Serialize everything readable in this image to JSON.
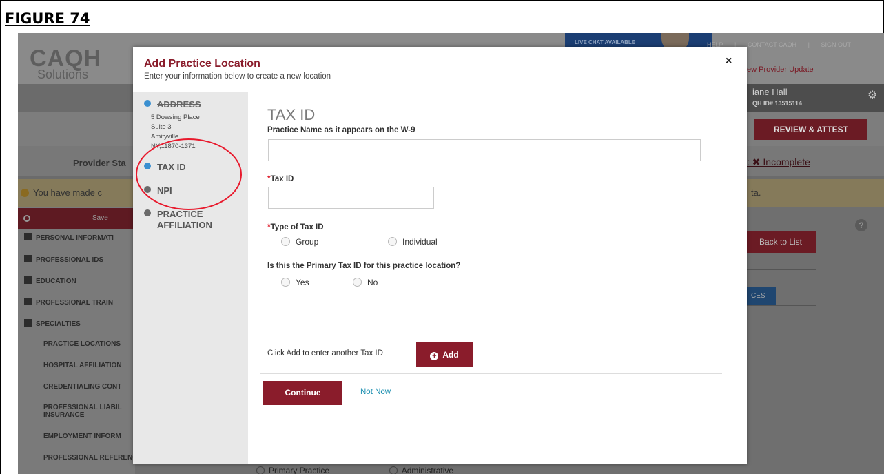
{
  "figure_title": "FIGURE 74",
  "background": {
    "logo_main": "CAQH",
    "logo_sub": "Solutions",
    "live_chat": "LIVE CHAT AVAILABLE",
    "top_links": [
      "HELP",
      "|",
      "CONTACT CAQH",
      "|",
      "SIGN OUT"
    ],
    "provider_update": "ew Provider Update",
    "user_name": "iane Hall",
    "user_id": "QH ID# 13515114",
    "review_attest": "REVIEW & ATTEST",
    "provider_status": "Provider Sta",
    "status_value": ": ✖ Incomplete",
    "warning_left": "You have made c",
    "warning_right": "ta.",
    "save": "Save",
    "back_to_list": "Back to List",
    "tab_partial": "CES",
    "help": "?",
    "nav": [
      "PERSONAL INFORMATI",
      "PROFESSIONAL IDS",
      "EDUCATION",
      "PROFESSIONAL TRAIN",
      "SPECIALTIES",
      "PRACTICE LOCATIONS",
      "HOSPITAL AFFILIATION",
      "CREDENTIALING CONT",
      "PROFESSIONAL LIABIL INSURANCE",
      "EMPLOYMENT INFORM",
      "PROFESSIONAL REFERENCES"
    ],
    "bottom_radio_1": "Primary Practice",
    "bottom_radio_2": "Administrative"
  },
  "modal": {
    "title": "Add Practice Location",
    "subtitle": "Enter your information below to create a new location",
    "close": "×",
    "steps": {
      "address": "ADDRESS",
      "address_lines": [
        "5 Dowsing Place",
        "Suite 3",
        "Amityville",
        "NY,11870-1371"
      ],
      "tax_id": "TAX ID",
      "npi": "NPI",
      "practice_affiliation_1": "PRACTICE",
      "practice_affiliation_2": "AFFILIATION"
    },
    "form": {
      "section_title": "TAX ID",
      "practice_name_label": "Practice Name as it appears on the W-9",
      "practice_name_value": "",
      "tax_id_label": "Tax ID",
      "tax_id_value": "",
      "type_label": "Type of Tax ID",
      "type_options": [
        "Group",
        "Individual"
      ],
      "primary_label": "Is this the Primary Tax ID for this practice location?",
      "primary_options": [
        "Yes",
        "No"
      ],
      "add_text": "Click Add to enter another Tax ID",
      "add_button": "Add",
      "continue_button": "Continue",
      "not_now_link": "Not Now"
    }
  },
  "colors": {
    "brand_red": "#8a1c2b",
    "annotation_circle": "#e8192c",
    "step_active": "#3a8fd0",
    "link": "#1b8fb0"
  }
}
